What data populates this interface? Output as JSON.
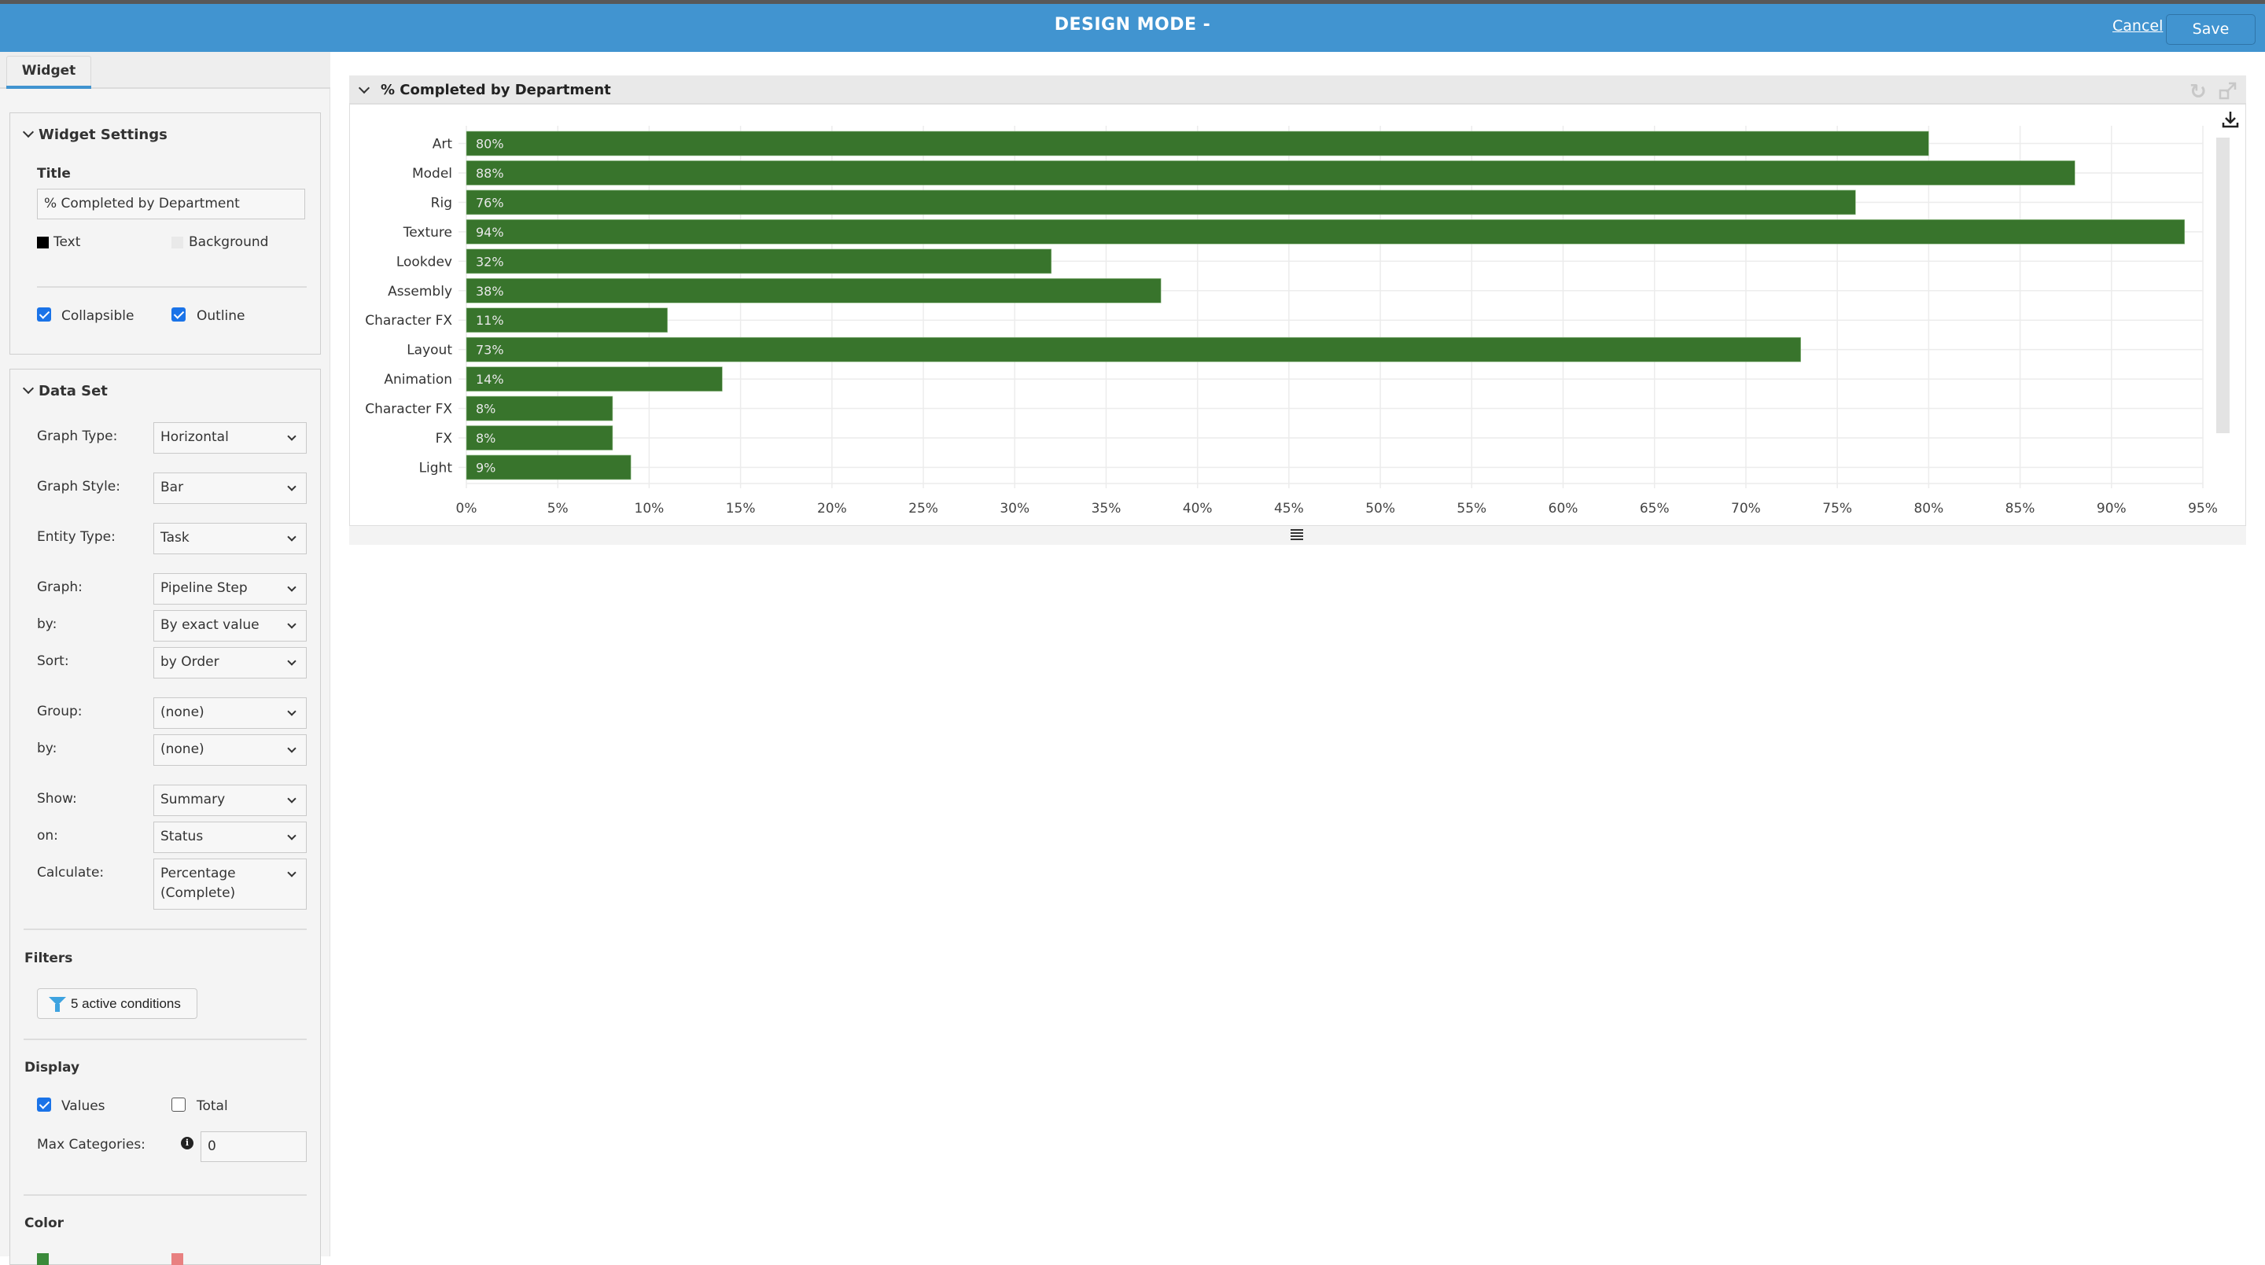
{
  "header": {
    "title": "DESIGN MODE -",
    "cancel_label": "Cancel",
    "save_label": "Save",
    "color": "#4194d0"
  },
  "left_panel": {
    "tabs": [
      {
        "label": "Widget",
        "active": true
      }
    ],
    "widget_settings": {
      "heading": "Widget Settings",
      "title_label": "Title",
      "title_value": "% Completed by Department",
      "text_color_label": "Text",
      "text_color": "#000000",
      "background_color_label": "Background",
      "background_color": "#e9e9e9",
      "collapsible_label": "Collapsible",
      "collapsible_checked": true,
      "outline_label": "Outline",
      "outline_checked": true
    },
    "data_set": {
      "heading": "Data Set",
      "fields": [
        {
          "label": "Graph Type:",
          "value": "Horizontal"
        },
        {
          "label": "Graph Style:",
          "value": "Bar"
        },
        {
          "label": "Entity Type:",
          "value": "Task"
        },
        {
          "label": "Graph:",
          "value": "Pipeline Step"
        },
        {
          "label": "by:",
          "value": "By exact value"
        },
        {
          "label": "Sort:",
          "value": "by Order"
        },
        {
          "label": "Group:",
          "value": "(none)"
        },
        {
          "label": "by:",
          "value": "(none)"
        },
        {
          "label": "Show:",
          "value": "Summary"
        },
        {
          "label": "on:",
          "value": "Status"
        },
        {
          "label": "Calculate:",
          "value": "Percentage",
          "value_line2": "(Complete)"
        }
      ]
    },
    "filters": {
      "heading": "Filters",
      "button_label": "5 active conditions"
    },
    "display": {
      "heading": "Display",
      "values_label": "Values",
      "values_checked": true,
      "total_label": "Total",
      "total_checked": false,
      "max_categories_label": "Max Categories:",
      "max_categories_value": "0",
      "info_glyph": "i"
    },
    "color": {
      "heading": "Color",
      "swatches": [
        "#3a8a3a",
        "#e88080"
      ]
    }
  },
  "widget": {
    "title": "% Completed by Department",
    "icons": [
      "refresh-icon",
      "expand-icon",
      "download-icon",
      "drag-handle-icon"
    ]
  },
  "chart_data": {
    "type": "bar",
    "orientation": "horizontal",
    "title": "% Completed by Department",
    "categories": [
      "Art",
      "Model",
      "Rig",
      "Texture",
      "Lookdev",
      "Assembly",
      "Character FX",
      "Layout",
      "Animation",
      "Character FX",
      "FX",
      "Light"
    ],
    "values": [
      80,
      88,
      76,
      94,
      32,
      38,
      11,
      73,
      14,
      8,
      8,
      9
    ],
    "value_labels": [
      "80%",
      "88%",
      "76%",
      "94%",
      "32%",
      "38%",
      "11%",
      "73%",
      "14%",
      "8%",
      "8%",
      "9%"
    ],
    "xlabel": "",
    "ylabel": "",
    "xlim": [
      0,
      95
    ],
    "x_ticks": [
      0,
      5,
      10,
      15,
      20,
      25,
      30,
      35,
      40,
      45,
      50,
      55,
      60,
      65,
      70,
      75,
      80,
      85,
      90,
      95
    ],
    "x_tick_labels": [
      "0%",
      "5%",
      "10%",
      "15%",
      "20%",
      "25%",
      "30%",
      "35%",
      "40%",
      "45%",
      "50%",
      "55%",
      "60%",
      "65%",
      "70%",
      "75%",
      "80%",
      "85%",
      "90%",
      "95%"
    ],
    "grid": true,
    "legend": "none",
    "bar_color": "#38742c"
  }
}
